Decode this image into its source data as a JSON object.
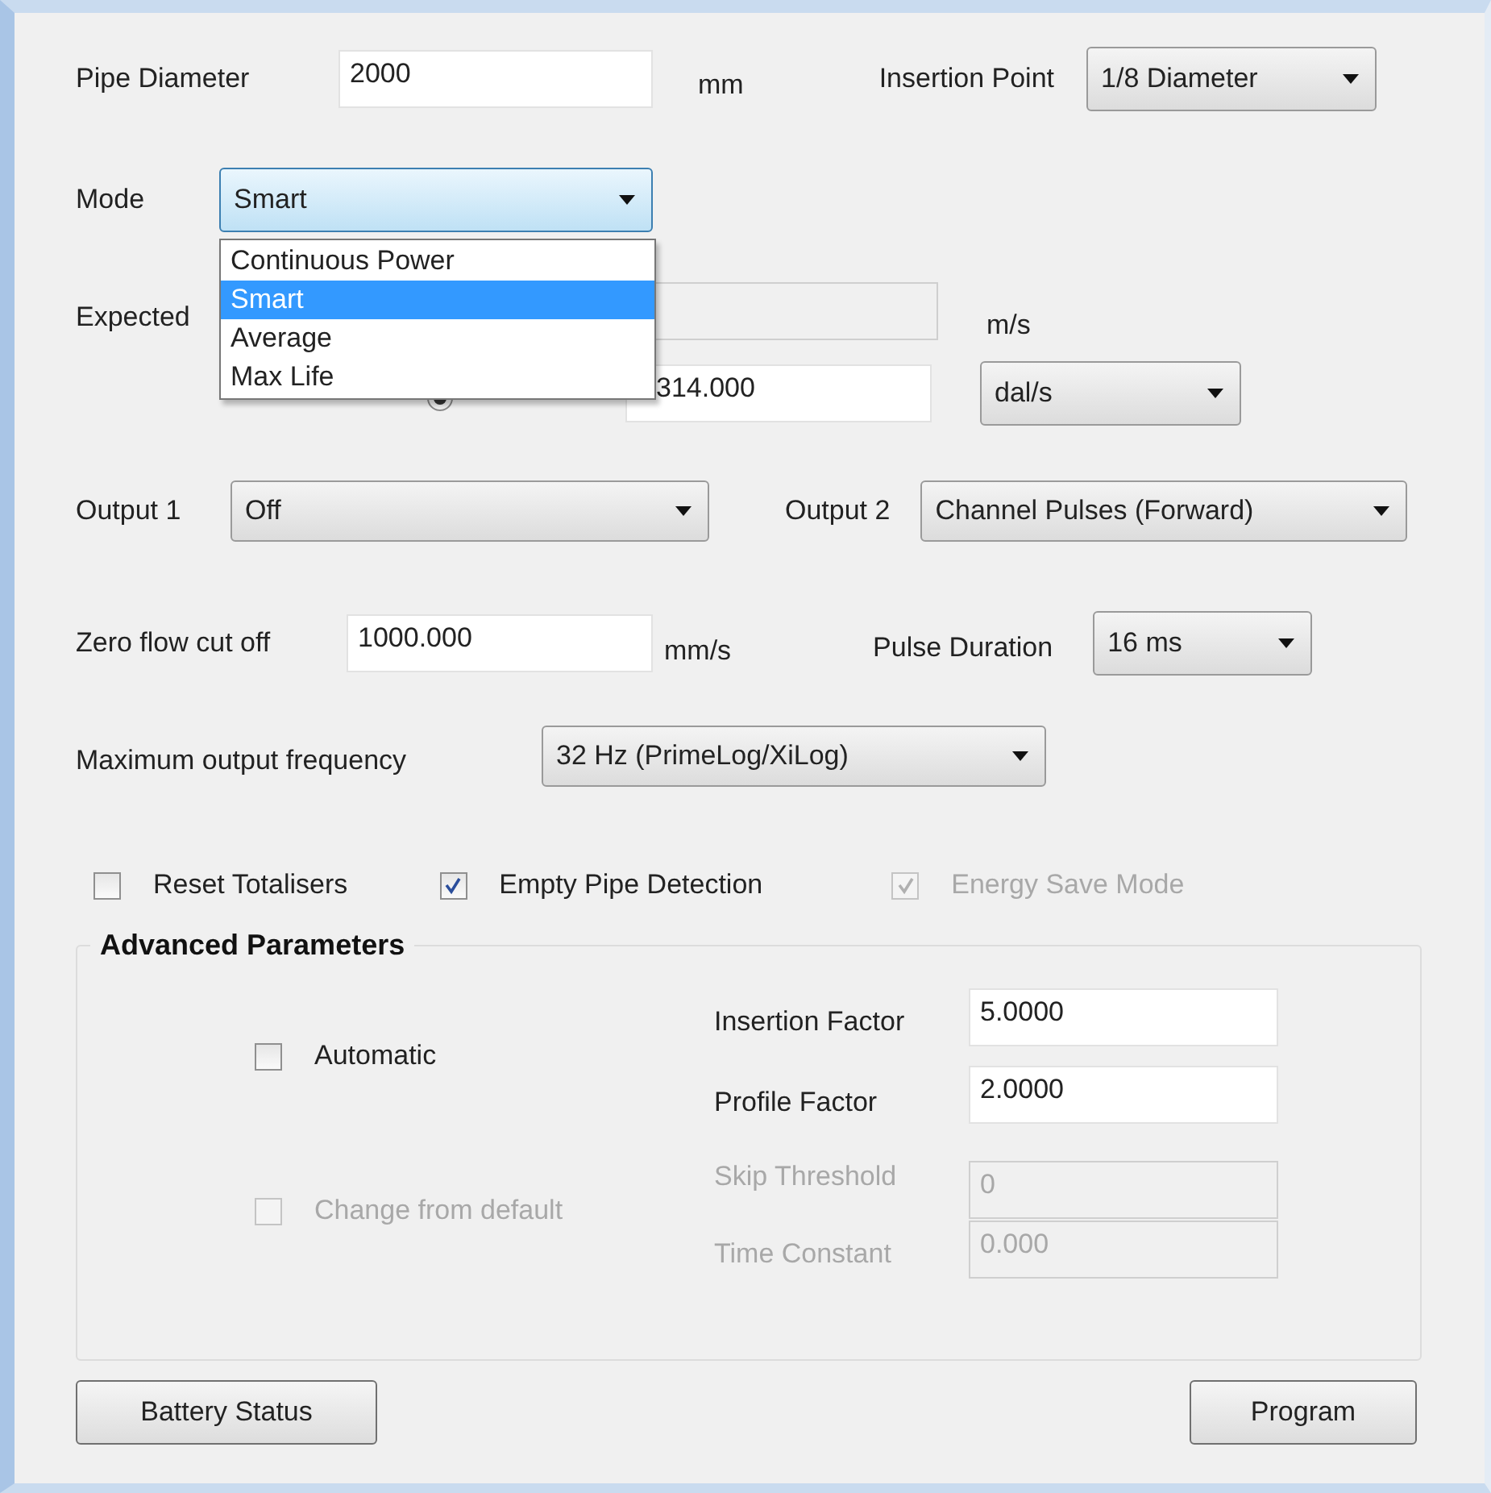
{
  "pipe_diameter": {
    "label": "Pipe Diameter",
    "value": "2000",
    "unit": "mm"
  },
  "insertion_point": {
    "label": "Insertion Point",
    "value": "1/8 Diameter"
  },
  "mode": {
    "label": "Mode",
    "value": "Smart",
    "expanded": true,
    "options": [
      {
        "label": "Continuous Power",
        "selected": false
      },
      {
        "label": "Smart",
        "selected": true
      },
      {
        "label": "Average",
        "selected": false
      },
      {
        "label": "Max Life",
        "selected": false
      }
    ]
  },
  "expected": {
    "label": "Expected",
    "velocity_unit": "m/s",
    "flow_selected": true,
    "flow_value": "314.000",
    "flow_unit": "dal/s"
  },
  "output_1": {
    "label": "Output 1",
    "value": "Off"
  },
  "output_2": {
    "label": "Output 2",
    "value": "Channel Pulses (Forward)"
  },
  "zero_flow": {
    "label": "Zero flow cut off",
    "value": "1000.000",
    "unit": "mm/s"
  },
  "pulse_duration": {
    "label": "Pulse Duration",
    "value": "16 ms"
  },
  "max_frequency": {
    "label": "Maximum output frequency",
    "value": "32 Hz (PrimeLog/XiLog)"
  },
  "options": [
    {
      "label": "Reset Totalisers",
      "checked": false,
      "disabled": false
    },
    {
      "label": "Empty Pipe Detection",
      "checked": true,
      "disabled": false
    },
    {
      "label": "Energy Save Mode",
      "checked": true,
      "disabled": true
    }
  ],
  "advanced": {
    "title": "Advanced Parameters",
    "automatic": {
      "label": "Automatic",
      "checked": false,
      "disabled": false
    },
    "change_default": {
      "label": "Change from default",
      "checked": false,
      "disabled": true
    },
    "fields": [
      {
        "label": "Insertion Factor",
        "value": "5.0000",
        "disabled": false
      },
      {
        "label": "Profile Factor",
        "value": "2.0000",
        "disabled": false
      },
      {
        "label": "Skip Threshold",
        "value": "0",
        "disabled": true
      },
      {
        "label": "Time Constant",
        "value": "0.000",
        "disabled": true
      }
    ]
  },
  "buttons": [
    "Battery Status",
    "Program"
  ]
}
